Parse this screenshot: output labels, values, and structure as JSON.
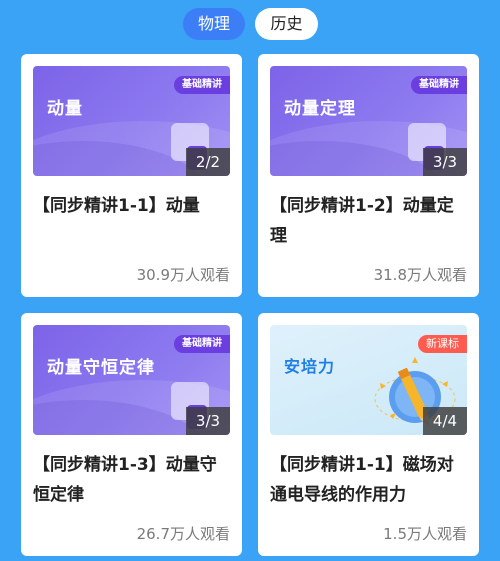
{
  "tabs": [
    {
      "label": "物理",
      "active": true
    },
    {
      "label": "历史",
      "active": false
    }
  ],
  "cards": [
    {
      "thumb_title": "动量",
      "tag": "基础精讲",
      "count": "2/2",
      "title": "【同步精讲1-1】动量",
      "views": "30.9万人观看"
    },
    {
      "thumb_title": "动量定理",
      "tag": "基础精讲",
      "count": "3/3",
      "title": "【同步精讲1-2】动量定理",
      "views": "31.8万人观看"
    },
    {
      "thumb_title": "动量守恒定律",
      "tag": "基础精讲",
      "count": "3/3",
      "title": "【同步精讲1-3】动量守恒定律",
      "views": "26.7万人观看"
    },
    {
      "thumb_title": "安培力",
      "tag": "新课标",
      "count": "4/4",
      "title": "【同步精讲1-1】磁场对通电导线的作用力",
      "views": "1.5万人观看"
    }
  ],
  "colors": {
    "background": "#3aa3f6",
    "tab_active": "#3b7ef6",
    "tag_purple": "#6b3ee0",
    "tag_red": "#ff5b4f"
  }
}
